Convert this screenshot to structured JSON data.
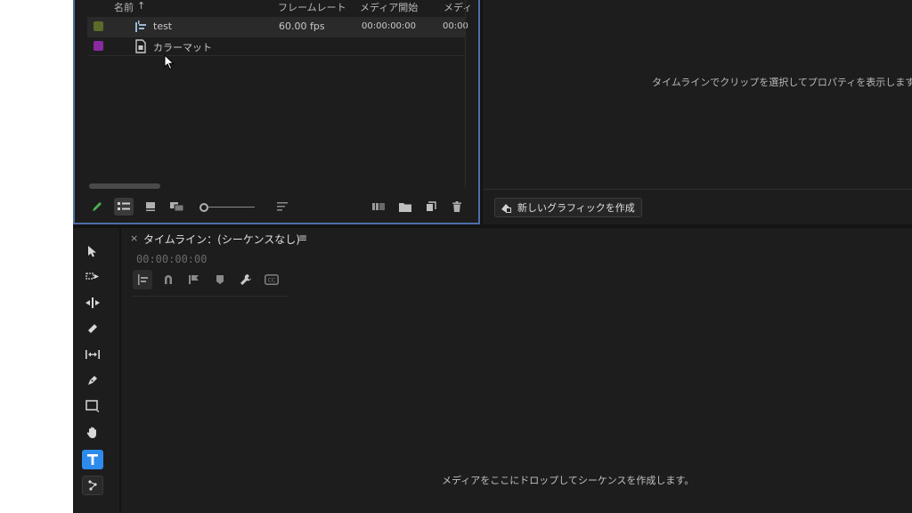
{
  "project": {
    "columns": {
      "name": "名前",
      "sort": "↑",
      "framerate": "フレームレート",
      "media_start": "メディア開始",
      "media_more": "メディ"
    },
    "items": [
      {
        "name": "test",
        "fps": "60.00 fps",
        "media_start": "00:00:00:00",
        "media_end": "00:00",
        "color": "#5a6b2a",
        "icon": "sequence-icon"
      },
      {
        "name": "カラーマット",
        "fps": "",
        "media_start": "",
        "media_end": "",
        "color": "#8a2aa0",
        "icon": "color-matte-icon"
      }
    ]
  },
  "properties": {
    "placeholder": "タイムラインでクリップを選択してプロパティを表示します",
    "new_graphic_label": "新しいグラフィックを作成"
  },
  "timeline": {
    "tab_close": "×",
    "title": "タイムライン：(シーケンスなし)",
    "menu": "≡",
    "timecode": "00:00:00:00",
    "drop_hint": "メディアをここにドロップしてシーケンスを作成します。"
  },
  "colors": {
    "accent": "#2d8ceb",
    "panel_border": "#4d6ea8",
    "bg": "#1d1d1d"
  }
}
